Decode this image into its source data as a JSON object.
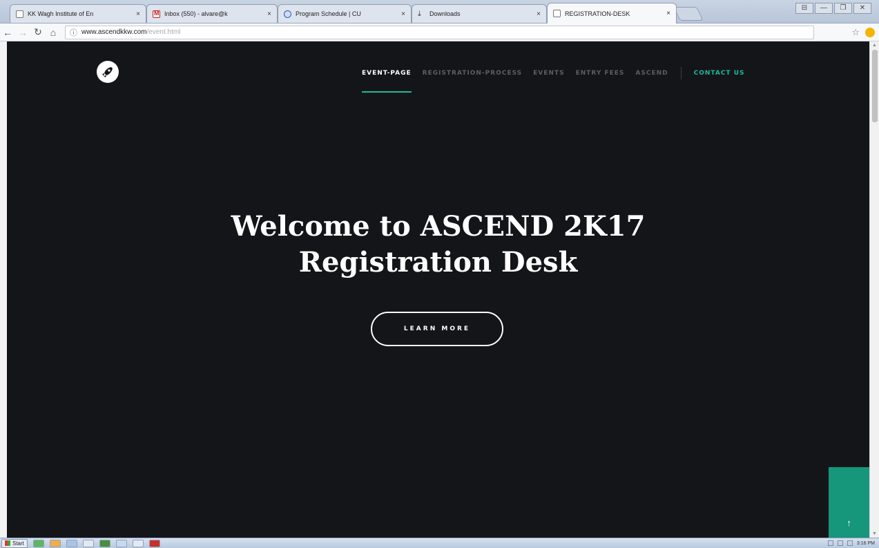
{
  "browser": {
    "tabs": [
      {
        "title": "KK Wagh Institute of En",
        "icon": "page-icon",
        "active": false
      },
      {
        "title": "Inbox (550) - alvare@k",
        "icon": "gmail-icon",
        "active": false
      },
      {
        "title": "Program Schedule | CU",
        "icon": "globe-icon",
        "active": false
      },
      {
        "title": "Downloads",
        "icon": "download-icon",
        "active": false
      },
      {
        "title": "REGISTRATION-DESK",
        "icon": "page-icon",
        "active": true
      }
    ],
    "tab_close_glyph": "×",
    "url_host": "www.ascendkkw.com",
    "url_path": "/event.html",
    "window_controls": [
      "⊟",
      "—",
      "❐",
      "✕"
    ]
  },
  "page": {
    "nav": {
      "items": [
        "EVENT-PAGE",
        "REGISTRATION-PROCESS",
        "EVENTS",
        "ENTRY FEES",
        "ASCEND"
      ],
      "active_index": 0,
      "contact": "CONTACT US"
    },
    "hero": {
      "line1": "Welcome to ASCEND 2K17",
      "line2": "Registration Desk"
    },
    "cta_label": "LEARN MORE",
    "back_to_top_glyph": "↑",
    "colors": {
      "accent": "#1abc9c",
      "background": "#141519",
      "back_to_top": "#16967a"
    }
  },
  "taskbar": {
    "start_label": "Start",
    "clock": "3:16 PM"
  }
}
